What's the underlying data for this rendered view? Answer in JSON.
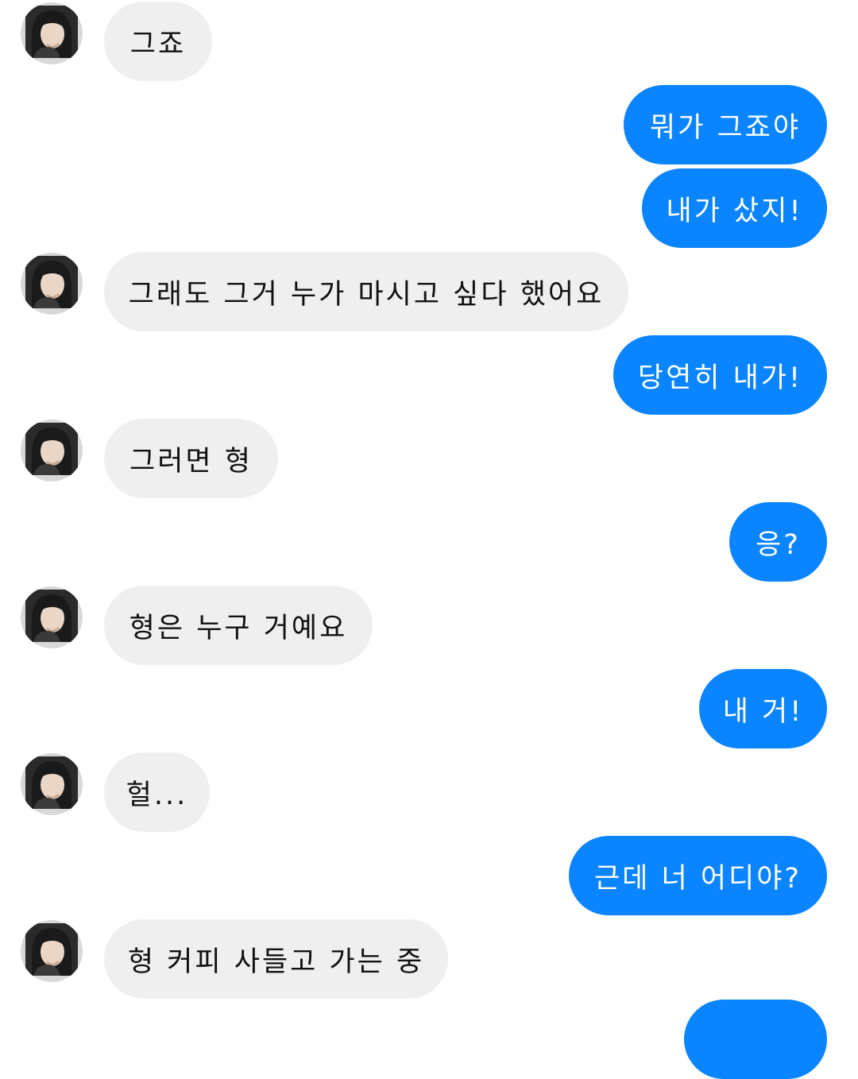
{
  "colors": {
    "incoming_bubble": "#efefef",
    "outgoing_bubble": "#0a84ff",
    "incoming_text": "#111111",
    "outgoing_text": "#ffffff"
  },
  "conversation": {
    "messages": [
      {
        "direction": "incoming",
        "text": "그죠",
        "avatar": "contact-avatar-photo"
      },
      {
        "direction": "outgoing",
        "text": "뭐가 그죠야"
      },
      {
        "direction": "outgoing",
        "text": "내가 샀지!"
      },
      {
        "direction": "incoming",
        "text": "그래도 그거 누가 마시고 싶다 했어요",
        "avatar": "contact-avatar-photo"
      },
      {
        "direction": "outgoing",
        "text": "당연히 내가!"
      },
      {
        "direction": "incoming",
        "text": "그러면 형",
        "avatar": "contact-avatar-photo"
      },
      {
        "direction": "outgoing",
        "text": "응?"
      },
      {
        "direction": "incoming",
        "text": "형은 누구 거예요",
        "avatar": "contact-avatar-photo"
      },
      {
        "direction": "outgoing",
        "text": "내 거!"
      },
      {
        "direction": "incoming",
        "text": "헐...",
        "avatar": "contact-avatar-photo"
      },
      {
        "direction": "outgoing",
        "text": "근데 너 어디야?"
      },
      {
        "direction": "incoming",
        "text": "형 커피 사들고 가는 중",
        "avatar": "contact-avatar-photo"
      }
    ]
  }
}
